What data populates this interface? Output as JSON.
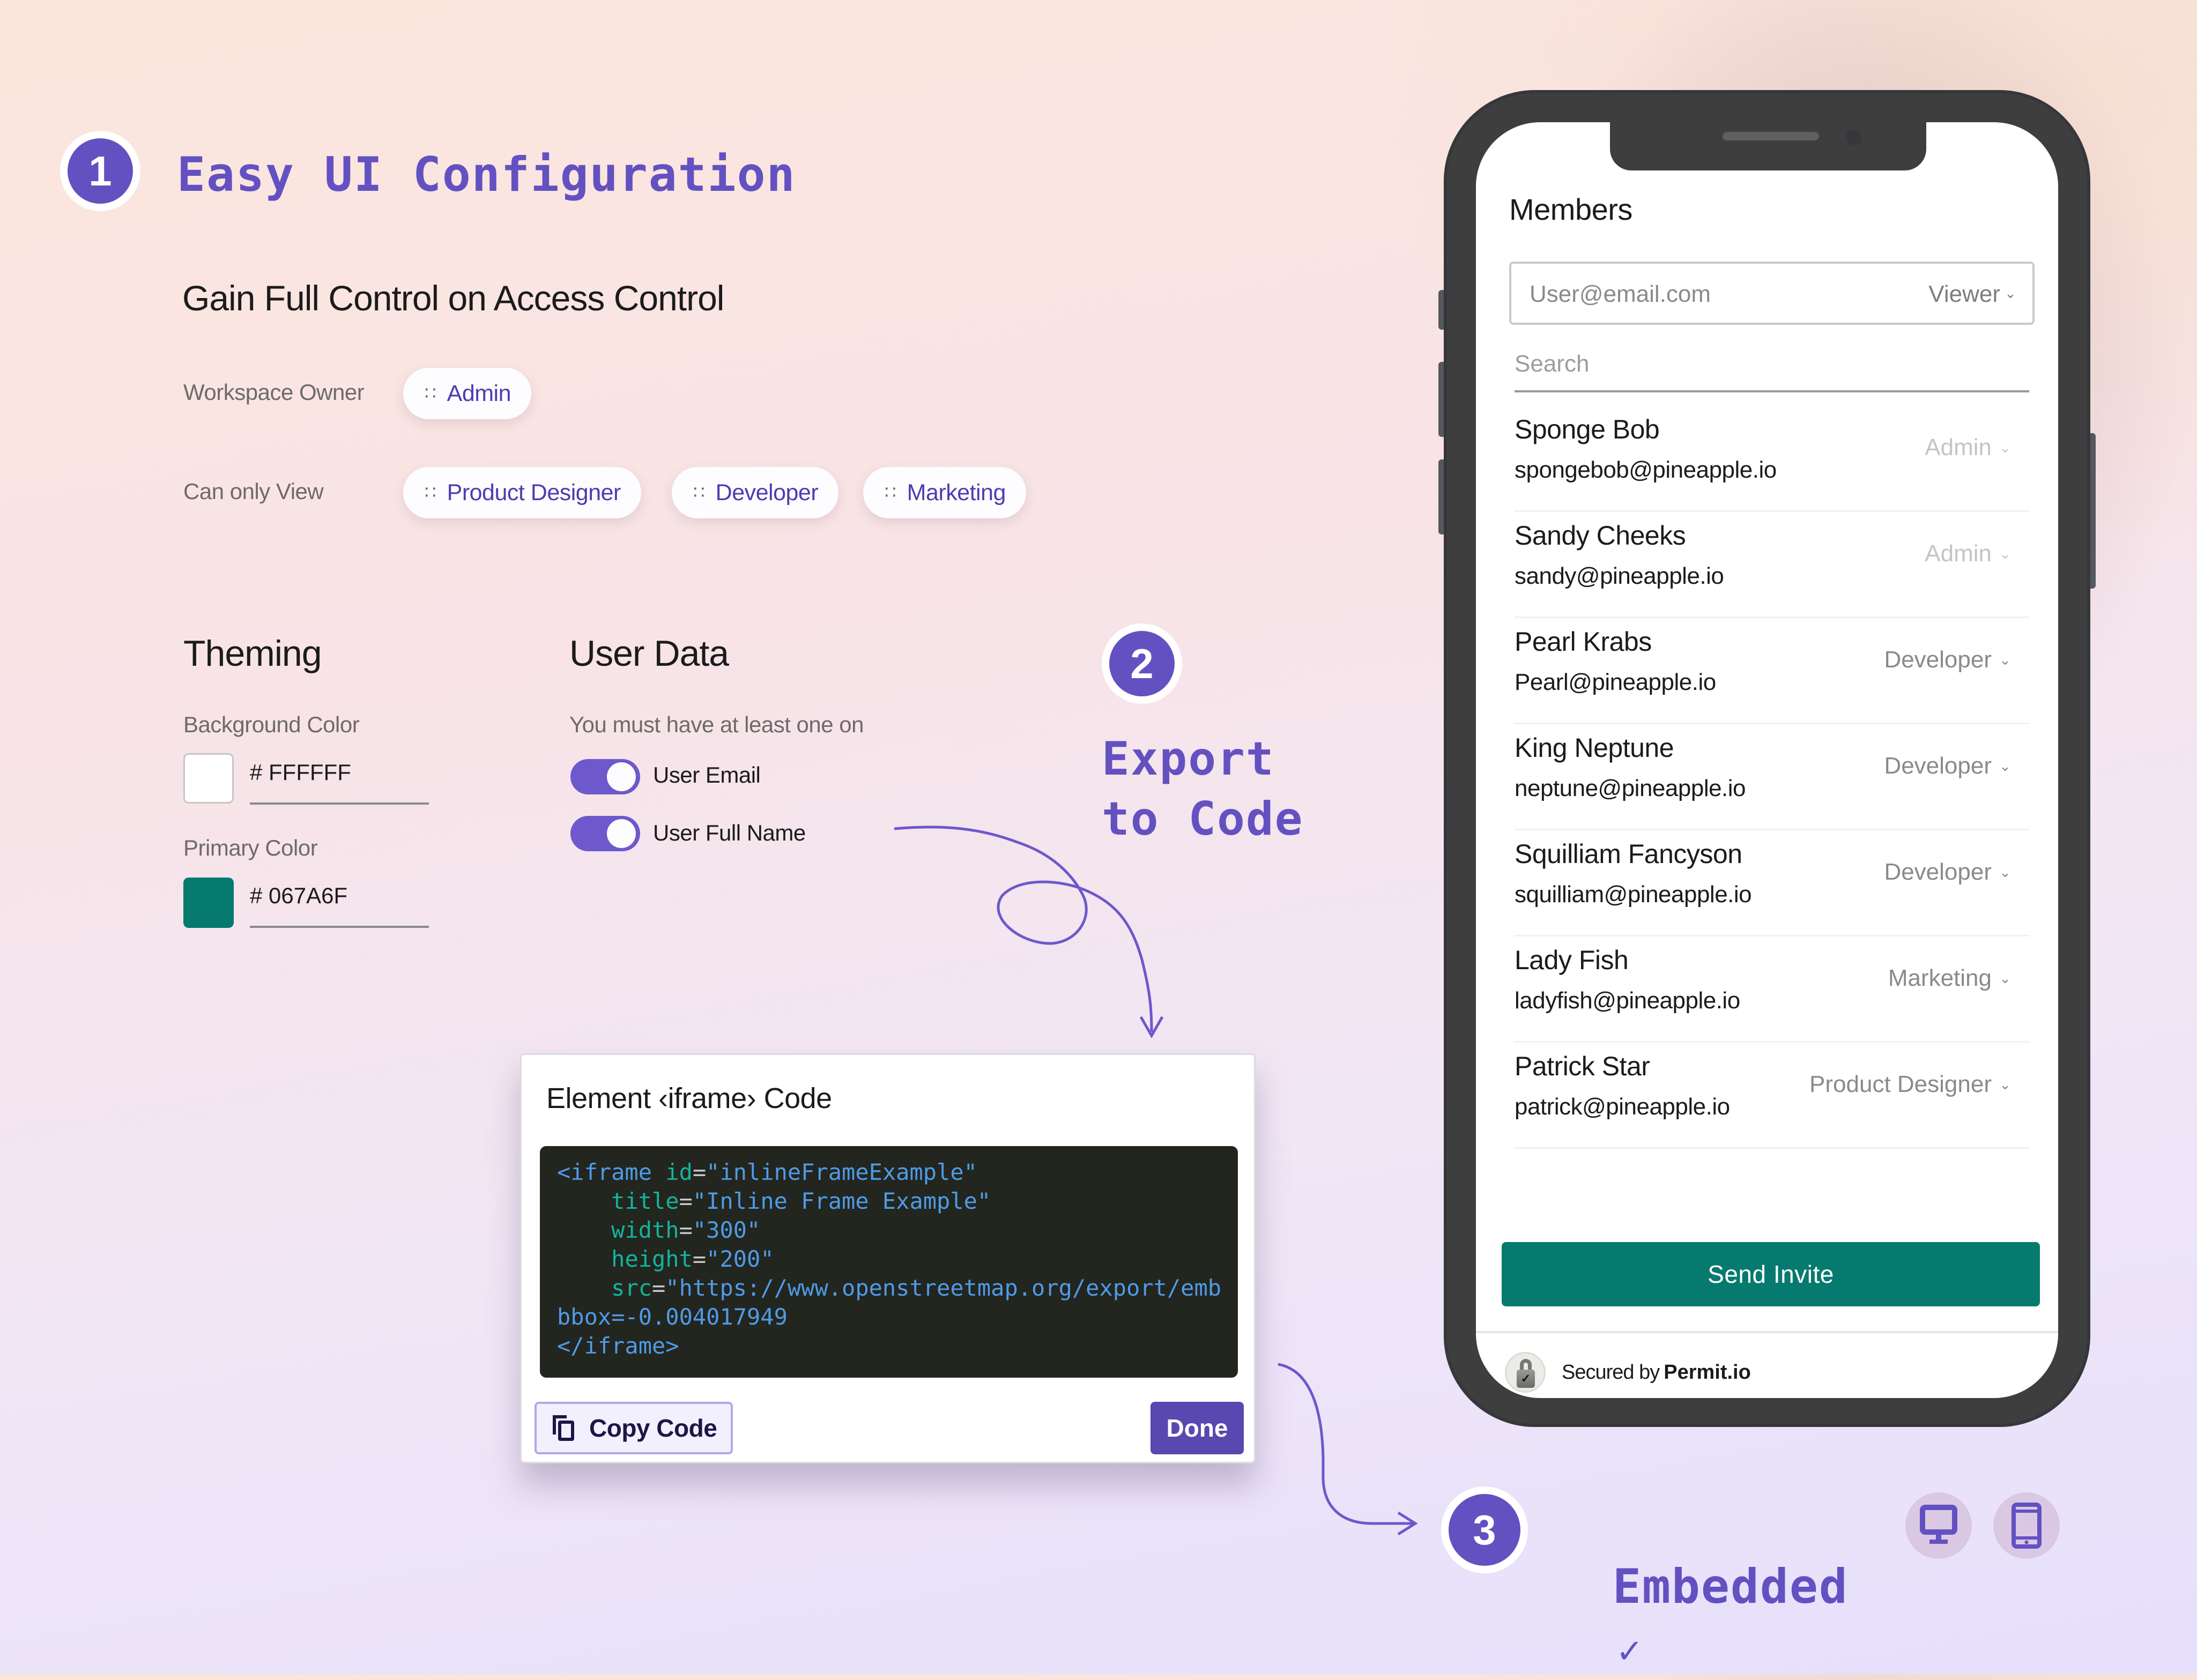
{
  "step1": {
    "number": "1",
    "title": "Easy UI Configuration",
    "subtitle": "Gain Full Control on Access Control",
    "workspace_owner": {
      "label": "Workspace Owner",
      "chips": [
        "Admin"
      ]
    },
    "can_only_view": {
      "label": "Can only View",
      "chips": [
        "Product Designer",
        "Developer",
        "Marketing"
      ]
    },
    "theming": {
      "title": "Theming",
      "background_color": {
        "label": "Background Color",
        "value": "# FFFFFF",
        "swatch": "#FFFFFF"
      },
      "primary_color": {
        "label": "Primary Color",
        "value": "# 067A6F",
        "swatch": "#067A6F"
      }
    },
    "user_data": {
      "title": "User Data",
      "hint": "You must have at least one on",
      "toggles": [
        {
          "label": "User Email",
          "on": true
        },
        {
          "label": "User Full Name",
          "on": true
        }
      ]
    }
  },
  "step2": {
    "number": "2",
    "title": "Export\nto Code",
    "card": {
      "title": "Element ‹iframe› Code",
      "code": [
        {
          "parts": [
            [
              "tag",
              "<iframe "
            ],
            [
              "attr",
              "id"
            ],
            [
              "eq",
              "="
            ],
            [
              "str",
              "\"inlineFrameExample\""
            ]
          ]
        },
        {
          "parts": [
            [
              "sp",
              "    "
            ],
            [
              "attr",
              "title"
            ],
            [
              "eq",
              "="
            ],
            [
              "str",
              "\"Inline Frame Example\""
            ]
          ]
        },
        {
          "parts": [
            [
              "sp",
              "    "
            ],
            [
              "attr",
              "width"
            ],
            [
              "eq",
              "="
            ],
            [
              "str",
              "\"300\""
            ]
          ]
        },
        {
          "parts": [
            [
              "sp",
              "    "
            ],
            [
              "attr",
              "height"
            ],
            [
              "eq",
              "="
            ],
            [
              "str",
              "\"200\""
            ]
          ]
        },
        {
          "parts": [
            [
              "sp",
              "    "
            ],
            [
              "attr",
              "src"
            ],
            [
              "eq",
              "="
            ],
            [
              "str",
              "\"https://www.openstreetmap.org/export/emb"
            ]
          ]
        },
        {
          "parts": [
            [
              "str",
              "bbox=-0.004017949"
            ]
          ]
        },
        {
          "parts": [
            [
              "tag",
              "</iframe>"
            ]
          ]
        }
      ],
      "copy_label": "Copy Code",
      "done_label": "Done"
    }
  },
  "step3": {
    "number": "3",
    "title": "Embedded",
    "check": "✓",
    "devices": [
      "desktop",
      "mobile"
    ]
  },
  "phone": {
    "title": "Members",
    "invite": {
      "placeholder": "User@email.com",
      "role": "Viewer"
    },
    "search_placeholder": "Search",
    "members": [
      {
        "name": "Sponge Bob",
        "email": "spongebob@pineapple.io",
        "role": "Admin",
        "disabled": true
      },
      {
        "name": "Sandy Cheeks",
        "email": "sandy@pineapple.io",
        "role": "Admin",
        "disabled": true
      },
      {
        "name": "Pearl Krabs",
        "email": "Pearl@pineapple.io",
        "role": "Developer",
        "disabled": false
      },
      {
        "name": "King Neptune",
        "email": "neptune@pineapple.io",
        "role": "Developer",
        "disabled": false
      },
      {
        "name": "Squilliam Fancyson",
        "email": "squilliam@pineapple.io",
        "role": "Developer",
        "disabled": false
      },
      {
        "name": "Lady Fish",
        "email": "ladyfish@pineapple.io",
        "role": "Marketing",
        "disabled": false
      },
      {
        "name": "Patrick Star",
        "email": "patrick@pineapple.io",
        "role": "Product Designer",
        "disabled": false
      }
    ],
    "send_invite_label": "Send Invite",
    "secured_by": "Secured by",
    "brand": "Permit.io"
  },
  "colors": {
    "accent": "#6351C2",
    "primary": "#067A6F",
    "code_bg": "#23251F"
  }
}
